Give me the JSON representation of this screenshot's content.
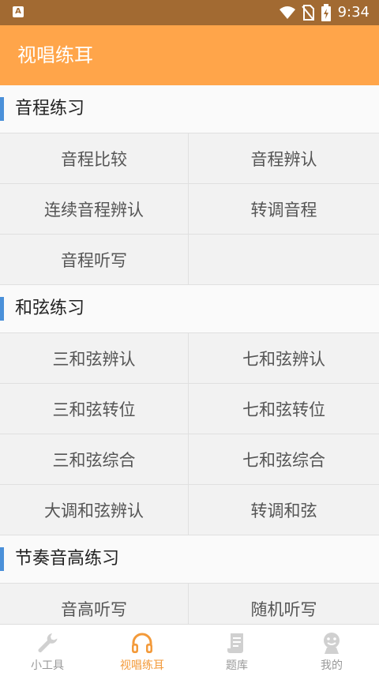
{
  "statusbar": {
    "time": "9:34",
    "app_badge": "A"
  },
  "appbar": {
    "title": "视唱练耳"
  },
  "sections": [
    {
      "title": "音程练习",
      "items": [
        "音程比较",
        "音程辨认",
        "连续音程辨认",
        "转调音程",
        "音程听写",
        ""
      ]
    },
    {
      "title": "和弦练习",
      "items": [
        "三和弦辨认",
        "七和弦辨认",
        "三和弦转位",
        "七和弦转位",
        "三和弦综合",
        "七和弦综合",
        "大调和弦辨认",
        "转调和弦"
      ]
    },
    {
      "title": "节奏音高练习",
      "items": [
        "音高听写",
        "随机听写"
      ]
    }
  ],
  "nav": {
    "items": [
      {
        "label": "小工具",
        "icon": "wrench-icon"
      },
      {
        "label": "视唱练耳",
        "icon": "headphones-icon"
      },
      {
        "label": "题库",
        "icon": "scroll-icon"
      },
      {
        "label": "我的",
        "icon": "profile-icon"
      }
    ],
    "active_index": 1,
    "active_color": "#f39a3a",
    "inactive_color": "#999999"
  },
  "colors": {
    "appbar": "#ffa54a",
    "statusbar": "#a26a32",
    "section_accent": "#4a90d9"
  }
}
